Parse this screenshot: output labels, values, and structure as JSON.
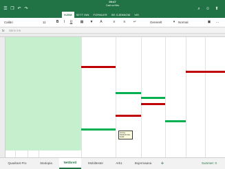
{
  "status": {
    "time": "09:47",
    "file": "Cash ow files"
  },
  "ribbon_tabs": [
    "HJEM",
    "SETT INN",
    "FORMLER",
    "SE GJENNOM",
    "VIS"
  ],
  "active_tab": "HJEM",
  "font": {
    "family": "Calibri",
    "size": "11"
  },
  "format_labels": {
    "bold": "B",
    "italic": "I",
    "underline": "U"
  },
  "number_format": "Generelt",
  "cell_style": "Normal",
  "formula": {
    "fx": "fx",
    "placeholder": "Skriv inn"
  },
  "sheet_tabs": [
    "Quadrant Pro",
    "Stedopia",
    "Nettbrett",
    "Mobiltester",
    "Ark1",
    "Bojermaana"
  ],
  "active_sheet": "Nettbrett",
  "add_sheet": "+",
  "sum_label": "Summer: 0",
  "comment_text": "Gurvig: Nettbrett ikke betalt",
  "colors": {
    "excel_green": "#217346",
    "highlight_green": "#c6efce",
    "red": "#c00000",
    "dark_green": "#00b050"
  }
}
